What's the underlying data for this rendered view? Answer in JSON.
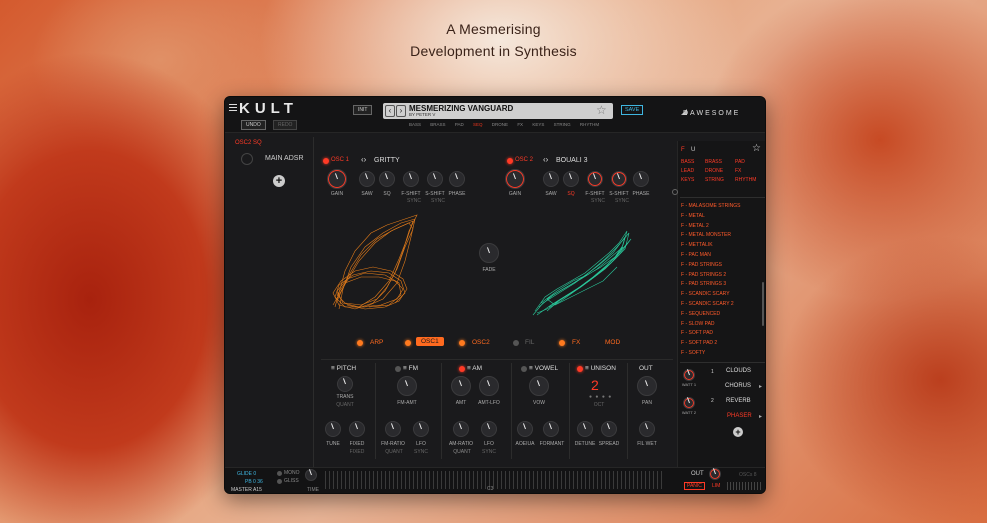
{
  "headline": {
    "line1": "A Mesmerising",
    "line2": "Development in Synthesis"
  },
  "topbar": {
    "logo": "KULT",
    "undo": "UNDO",
    "redo": "REDO",
    "init": "INIT",
    "preset_name": "MESMERIZING VANGUARD",
    "preset_author": "BY   PETER V",
    "save": "SAVE",
    "brand": "DAWESOME",
    "categories": [
      "BASS",
      "BRASS",
      "PAD",
      "SEQ",
      "DRONE",
      "FX",
      "KEYS",
      "STRING",
      "RHYTHM"
    ],
    "active_category": "SEQ"
  },
  "mod": {
    "source": "OSC2 SQ",
    "adsr_label": "MAIN ADSR",
    "add_symbol": "+"
  },
  "osc1": {
    "tab": "OSC 1",
    "model": "GRITTY",
    "knobs": [
      "GAIN",
      "SAW",
      "SQ",
      "F-SHIFT",
      "S-SHIFT",
      "PHASE"
    ],
    "sync1": "SYNC",
    "sync2": "SYNC"
  },
  "osc2": {
    "tab": "OSC 2",
    "model": "BOUALI 3",
    "knobs": [
      "GAIN",
      "SAW",
      "SQ",
      "F-SHIFT",
      "S-SHIFT",
      "PHASE"
    ],
    "sync1": "SYNC",
    "sync2": "SYNC"
  },
  "fade_label": "FADE",
  "tabs": [
    {
      "label": "ARP",
      "state": "on"
    },
    {
      "label": "OSC1",
      "state": "active"
    },
    {
      "label": "OSC2",
      "state": "on"
    },
    {
      "label": "FIL",
      "state": "off"
    },
    {
      "label": "FX",
      "state": "on"
    },
    {
      "label": "MOD",
      "state": "plain"
    }
  ],
  "modules": {
    "pitch": {
      "title": "PITCH",
      "trans": "TRANS",
      "quant": "QUANT",
      "tune": "TUNE",
      "fixed": "FIXED",
      "fixed_sub": "FIXED"
    },
    "fm": {
      "title": "FM",
      "amt": "FM-AMT",
      "ratio": "FM-RATIO",
      "lfo": "LFO",
      "quant": "QUANT",
      "sync": "SYNC"
    },
    "am": {
      "title": "AM",
      "amt": "AMT",
      "amt_lfo": "AMT-LFO",
      "ratio": "AM-RATIO",
      "lfo": "LFO",
      "quant": "QUANT",
      "sync": "SYNC"
    },
    "vowel": {
      "title": "VOWEL",
      "vow": "VOW",
      "aoeiua": "AOEIUA",
      "formant": "FORMANT"
    },
    "unison": {
      "title": "UNISON",
      "value": "2",
      "oct": "OCT",
      "detune": "DETUNE",
      "spread": "SPREAD"
    },
    "out": {
      "title": "OUT",
      "pan": "PAN",
      "fil_wet": "FIL WET"
    }
  },
  "sidebar": {
    "letters": [
      "F",
      "U"
    ],
    "star": "☆",
    "categories": [
      "BASS",
      "BRASS",
      "PAD",
      "LEAD",
      "DRONE",
      "FX",
      "KEYS",
      "STRING",
      "RHYTHM"
    ],
    "presets": [
      "F - MALASOME STRINGS",
      "F - METAL",
      "F - METAL 2",
      "F - METAL MONSTER",
      "F - METTALIK",
      "F - PAC MAN",
      "F - PAD STRINGS",
      "F - PAD STRINGS 2",
      "F - PAD STRINGS 3",
      "F - SCANDIC SCARY",
      "F - SCANDIC SCARY 2",
      "F - SEQUENCED",
      "F - SLOW PAD",
      "F - SOFT PAD",
      "F - SOFT PAD 2",
      "F - SOFTY"
    ],
    "fx": {
      "watt1": "WATT 1",
      "watt2": "WATT 2",
      "slot1_num": "1",
      "slot2_num": "2",
      "clouds": "CLOUDS",
      "chorus": "CHORUS",
      "reverb": "REVERB",
      "phaser": "PHASER",
      "add": "+"
    }
  },
  "bottom": {
    "glide": "GLIDE 0",
    "pb": "PB 0  36",
    "master": "MASTER A15",
    "mono": "MONO",
    "gliss": "GLISS",
    "time": "TIME",
    "note": "C3",
    "out": "OUT",
    "panic": "PANIC",
    "lim": "LIM",
    "osc_count": "OSCs  8"
  },
  "colors": {
    "accent_red": "#ff3a26",
    "accent_orange": "#ff6a1f",
    "osc1_wave": "#e07a1a",
    "osc2_wave": "#2ac79a",
    "save_blue": "#3fb6e0"
  }
}
